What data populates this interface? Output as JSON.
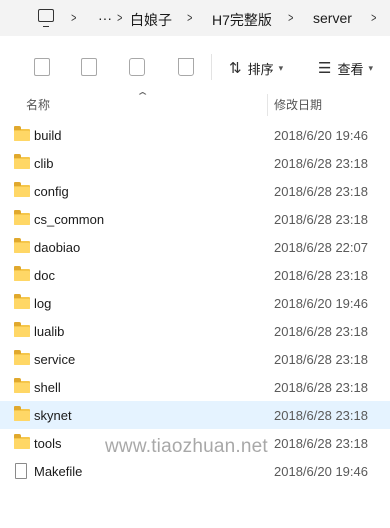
{
  "address": {
    "more": "···",
    "crumbs": [
      "白娘子",
      "H7完整版",
      "server"
    ]
  },
  "toolbar": {
    "icons": [
      "copy-icon",
      "rename-icon",
      "share-icon",
      "delete-icon"
    ],
    "sort_label": "排序",
    "view_label": "查看"
  },
  "header": {
    "name_col": "名称",
    "date_col": "修改日期"
  },
  "files": [
    {
      "name": "build",
      "date": "2018/6/20 19:46",
      "kind": "folder"
    },
    {
      "name": "clib",
      "date": "2018/6/28 23:18",
      "kind": "folder"
    },
    {
      "name": "config",
      "date": "2018/6/28 23:18",
      "kind": "folder"
    },
    {
      "name": "cs_common",
      "date": "2018/6/28 23:18",
      "kind": "folder"
    },
    {
      "name": "daobiao",
      "date": "2018/6/28 22:07",
      "kind": "folder"
    },
    {
      "name": "doc",
      "date": "2018/6/28 23:18",
      "kind": "folder"
    },
    {
      "name": "log",
      "date": "2018/6/20 19:46",
      "kind": "folder"
    },
    {
      "name": "lualib",
      "date": "2018/6/28 23:18",
      "kind": "folder"
    },
    {
      "name": "service",
      "date": "2018/6/28 23:18",
      "kind": "folder"
    },
    {
      "name": "shell",
      "date": "2018/6/28 23:18",
      "kind": "folder"
    },
    {
      "name": "skynet",
      "date": "2018/6/28 23:18",
      "kind": "folder",
      "selected": true
    },
    {
      "name": "tools",
      "date": "2018/6/28 23:18",
      "kind": "folder"
    },
    {
      "name": "Makefile",
      "date": "2018/6/20 19:46",
      "kind": "file"
    }
  ],
  "watermark": "www.tiaozhuan.net",
  "colors": {
    "selected_row": "#e5f3ff",
    "folder": "#ffd766"
  }
}
